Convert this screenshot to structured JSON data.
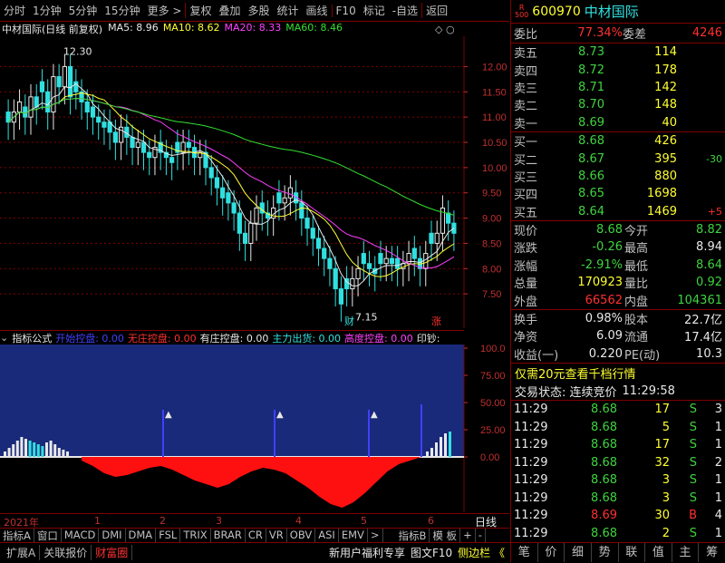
{
  "toolbar": {
    "items": [
      "分时",
      "1分钟",
      "5分钟",
      "15分钟",
      "更多 >",
      "复权",
      "叠加",
      "多股",
      "统计",
      "画线",
      "F10",
      "标记",
      "-自选",
      "返回"
    ]
  },
  "main_chart": {
    "title": "中材国际(日线 前复权)",
    "ma": [
      {
        "label": "MA5:",
        "value": "8.96",
        "color": "#e8e8e8"
      },
      {
        "label": "MA10:",
        "value": "8.62",
        "color": "#ffff30"
      },
      {
        "label": "MA20:",
        "value": "8.33",
        "color": "#ff40ff"
      },
      {
        "label": "MA60:",
        "value": "8.46",
        "color": "#30e030"
      }
    ],
    "high_label": "12.30",
    "low_label": "7.15",
    "ylim": [
      7.0,
      12.6
    ],
    "yticks": [
      "12.00",
      "11.50",
      "11.00",
      "10.50",
      "10.00",
      "9.50",
      "9.00",
      "8.50",
      "8.00",
      "7.50"
    ],
    "flags": [
      "财",
      "涨"
    ]
  },
  "indicator": {
    "name": "指标公式",
    "params": [
      {
        "label": "开始控盘:",
        "value": "0.00",
        "color": "#4040ff"
      },
      {
        "label": "无庄控盘:",
        "value": "0.00",
        "color": "#ff3030"
      },
      {
        "label": "有庄控盘:",
        "value": "0.00",
        "color": "#e8e8e8"
      },
      {
        "label": "主力出货:",
        "value": "0.00",
        "color": "#30e0e0"
      },
      {
        "label": "高度控盘:",
        "value": "0.00",
        "color": "#ff40ff"
      },
      {
        "label": "印钞:",
        "value": "",
        "color": "#e8e8e8"
      }
    ],
    "yticks": [
      "100.0",
      "75.00",
      "50.00",
      "25.00",
      "0.00"
    ]
  },
  "xaxis": {
    "labels": [
      "2021年",
      "1",
      "2",
      "3",
      "4",
      "5",
      "6"
    ],
    "period": "日线"
  },
  "tabs": [
    "指标A",
    "窗口",
    "MACD",
    "DMI",
    "DMA",
    "FSL",
    "TRIX",
    "BRAR",
    "CR",
    "VR",
    "OBV",
    "ASI",
    "EMV",
    ">",
    "指标B",
    "模 板",
    "+",
    "-"
  ],
  "bottom_left": [
    "扩展A",
    "关联报价",
    "财富圈"
  ],
  "bottom_mid": [
    "新用户福利专享",
    "图文F10",
    "侧边栏 《"
  ],
  "stock": {
    "code": "600970",
    "name": "中材国际",
    "badge_top": "R",
    "badge_bot": "500"
  },
  "weibi": {
    "label": "委比",
    "value": "77.34%",
    "diff_label": "委差",
    "diff": "4246"
  },
  "asks": [
    {
      "label": "卖五",
      "price": "8.73",
      "vol": "114",
      "chg": ""
    },
    {
      "label": "卖四",
      "price": "8.72",
      "vol": "178",
      "chg": ""
    },
    {
      "label": "卖三",
      "price": "8.71",
      "vol": "142",
      "chg": ""
    },
    {
      "label": "卖二",
      "price": "8.70",
      "vol": "148",
      "chg": ""
    },
    {
      "label": "卖一",
      "price": "8.69",
      "vol": "40",
      "chg": ""
    }
  ],
  "bids": [
    {
      "label": "买一",
      "price": "8.68",
      "vol": "426",
      "chg": ""
    },
    {
      "label": "买二",
      "price": "8.67",
      "vol": "395",
      "chg": "-30"
    },
    {
      "label": "买三",
      "price": "8.66",
      "vol": "880",
      "chg": ""
    },
    {
      "label": "买四",
      "price": "8.65",
      "vol": "1698",
      "chg": ""
    },
    {
      "label": "买五",
      "price": "8.64",
      "vol": "1469",
      "chg": "+5"
    }
  ],
  "quote": [
    {
      "l1": "现价",
      "v1": "8.68",
      "c1": "g",
      "l2": "今开",
      "v2": "8.82",
      "c2": "g"
    },
    {
      "l1": "涨跌",
      "v1": "-0.26",
      "c1": "g",
      "l2": "最高",
      "v2": "8.94",
      "c2": "w"
    },
    {
      "l1": "涨幅",
      "v1": "-2.91%",
      "c1": "g",
      "l2": "最低",
      "v2": "8.64",
      "c2": "g"
    },
    {
      "l1": "总量",
      "v1": "170923",
      "c1": "y",
      "l2": "量比",
      "v2": "0.92",
      "c2": "g"
    },
    {
      "l1": "外盘",
      "v1": "66562",
      "c1": "r",
      "l2": "内盘",
      "v2": "104361",
      "c2": "g"
    }
  ],
  "quote2": [
    {
      "l1": "换手",
      "v1": "0.98%",
      "l2": "股本",
      "v2": "22.7亿"
    },
    {
      "l1": "净资",
      "v1": "6.09",
      "l2": "流通",
      "v2": "17.4亿"
    },
    {
      "l1": "收益(一)",
      "v1": "0.220",
      "l2": "PE(动)",
      "v2": "10.3"
    }
  ],
  "promo": "仅需20元查看千档行情",
  "trade_status": {
    "label": "交易状态: 连续竞价",
    "time": "11:29:58"
  },
  "ticks": [
    {
      "t": "11:29",
      "p": "8.68",
      "v": "17",
      "s": "S",
      "n": "3"
    },
    {
      "t": "11:29",
      "p": "8.68",
      "v": "5",
      "s": "S",
      "n": "1"
    },
    {
      "t": "11:29",
      "p": "8.68",
      "v": "17",
      "s": "S",
      "n": "1"
    },
    {
      "t": "11:29",
      "p": "8.68",
      "v": "32",
      "s": "S",
      "n": "2"
    },
    {
      "t": "11:29",
      "p": "8.68",
      "v": "3",
      "s": "S",
      "n": "1"
    },
    {
      "t": "11:29",
      "p": "8.68",
      "v": "3",
      "s": "S",
      "n": "1"
    },
    {
      "t": "11:29",
      "p": "8.69",
      "v": "30",
      "s": "B",
      "n": "4"
    },
    {
      "t": "11:29",
      "p": "8.68",
      "v": "2",
      "s": "S",
      "n": "1"
    }
  ],
  "side_tabs": [
    "笔",
    "价",
    "细",
    "势",
    "联",
    "值",
    "主",
    "筹"
  ]
}
